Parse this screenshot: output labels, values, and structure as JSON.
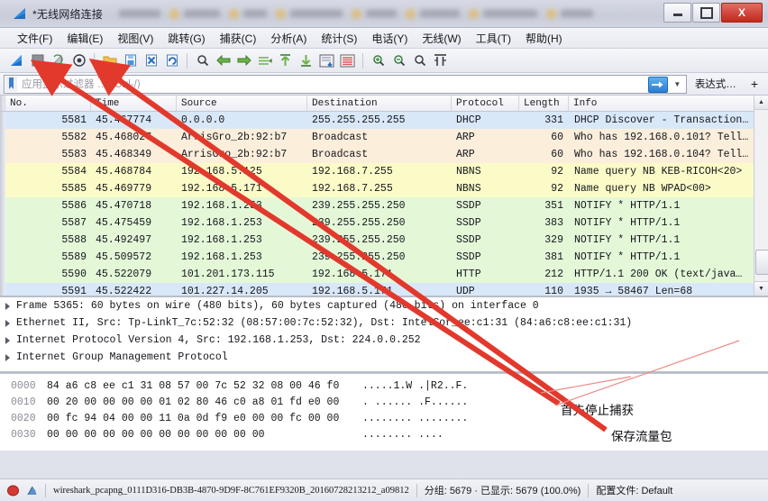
{
  "window": {
    "title": "*无线网络连接",
    "app_icon": "wireshark-fin-icon",
    "minimize_label": "",
    "maximize_label": "",
    "close_label": "X"
  },
  "menu": {
    "items": [
      {
        "label": "文件(F)",
        "name": "menu-file"
      },
      {
        "label": "编辑(E)",
        "name": "menu-edit"
      },
      {
        "label": "视图(V)",
        "name": "menu-view"
      },
      {
        "label": "跳转(G)",
        "name": "menu-go"
      },
      {
        "label": "捕获(C)",
        "name": "menu-capture"
      },
      {
        "label": "分析(A)",
        "name": "menu-analyze"
      },
      {
        "label": "统计(S)",
        "name": "menu-statistics"
      },
      {
        "label": "电话(Y)",
        "name": "menu-telephony"
      },
      {
        "label": "无线(W)",
        "name": "menu-wireless"
      },
      {
        "label": "工具(T)",
        "name": "menu-tools"
      },
      {
        "label": "帮助(H)",
        "name": "menu-help"
      }
    ]
  },
  "toolbar": {
    "buttons": [
      {
        "name": "start-capture-icon",
        "glyph": "start"
      },
      {
        "name": "stop-capture-icon",
        "glyph": "stop"
      },
      {
        "name": "restart-capture-icon",
        "glyph": "restart"
      },
      {
        "name": "capture-options-icon",
        "glyph": "options"
      },
      {
        "name": "open-file-icon",
        "glyph": "open"
      },
      {
        "name": "save-file-icon",
        "glyph": "save"
      },
      {
        "name": "close-file-icon",
        "glyph": "close"
      },
      {
        "name": "reload-file-icon",
        "glyph": "reload"
      },
      {
        "name": "find-packet-icon",
        "glyph": "find"
      },
      {
        "name": "go-back-icon",
        "glyph": "back"
      },
      {
        "name": "go-forward-icon",
        "glyph": "forward"
      },
      {
        "name": "go-to-packet-icon",
        "glyph": "goto"
      },
      {
        "name": "go-first-packet-icon",
        "glyph": "first"
      },
      {
        "name": "go-last-packet-icon",
        "glyph": "last"
      },
      {
        "name": "auto-scroll-icon",
        "glyph": "autoscroll"
      },
      {
        "name": "colorize-icon",
        "glyph": "colorize"
      },
      {
        "name": "zoom-in-icon",
        "glyph": "zoomin"
      },
      {
        "name": "zoom-out-icon",
        "glyph": "zoomout"
      },
      {
        "name": "zoom-reset-icon",
        "glyph": "zoomreset"
      },
      {
        "name": "resize-columns-icon",
        "glyph": "resizecols"
      }
    ]
  },
  "filter": {
    "placeholder": "应用显示过滤器 … ⟨Ctrl-/⟩",
    "value": "",
    "bookmark_icon": "bookmark-icon",
    "apply_icon": "arrow-right-icon",
    "dropdown_icon": "chevron-down-icon",
    "expression_label": "表达式…",
    "plus_label": "+"
  },
  "packet_list": {
    "columns": [
      "No.",
      "Time",
      "Source",
      "Destination",
      "Protocol",
      "Length",
      "Info"
    ],
    "rows": [
      {
        "no": "5581",
        "time": "45.467774",
        "src": "0.0.0.0",
        "dst": "255.255.255.255",
        "proto": "DHCP",
        "len": "331",
        "info": "DHCP Discover - Transaction…",
        "color": "selected"
      },
      {
        "no": "5582",
        "time": "45.468027",
        "src": "ArrisGro_2b:92:b7",
        "dst": "Broadcast",
        "proto": "ARP",
        "len": "60",
        "info": "Who has 192.168.0.101? Tell…",
        "color": "tan"
      },
      {
        "no": "5583",
        "time": "45.468349",
        "src": "ArrisGro_2b:92:b7",
        "dst": "Broadcast",
        "proto": "ARP",
        "len": "60",
        "info": "Who has 192.168.0.104? Tell…",
        "color": "tan"
      },
      {
        "no": "5584",
        "time": "45.468784",
        "src": "192.168.5.125",
        "dst": "192.168.7.255",
        "proto": "NBNS",
        "len": "92",
        "info": "Name query NB KEB-RICOH<20>",
        "color": "yellow"
      },
      {
        "no": "5585",
        "time": "45.469779",
        "src": "192.168.5.171",
        "dst": "192.168.7.255",
        "proto": "NBNS",
        "len": "92",
        "info": "Name query NB WPAD<00>",
        "color": "yellow"
      },
      {
        "no": "5586",
        "time": "45.470718",
        "src": "192.168.1.253",
        "dst": "239.255.255.250",
        "proto": "SSDP",
        "len": "351",
        "info": "NOTIFY * HTTP/1.1",
        "color": "green"
      },
      {
        "no": "5587",
        "time": "45.475459",
        "src": "192.168.1.253",
        "dst": "239.255.255.250",
        "proto": "SSDP",
        "len": "383",
        "info": "NOTIFY * HTTP/1.1",
        "color": "green"
      },
      {
        "no": "5588",
        "time": "45.492497",
        "src": "192.168.1.253",
        "dst": "239.255.255.250",
        "proto": "SSDP",
        "len": "329",
        "info": "NOTIFY * HTTP/1.1",
        "color": "green"
      },
      {
        "no": "5589",
        "time": "45.509572",
        "src": "192.168.1.253",
        "dst": "239.255.255.250",
        "proto": "SSDP",
        "len": "381",
        "info": "NOTIFY * HTTP/1.1",
        "color": "green"
      },
      {
        "no": "5590",
        "time": "45.522079",
        "src": "101.201.173.115",
        "dst": "192.168.5.171",
        "proto": "HTTP",
        "len": "212",
        "info": "HTTP/1.1 200 OK  (text/java…",
        "color": "green"
      },
      {
        "no": "5591",
        "time": "45.522422",
        "src": "101.227.14.205",
        "dst": "192.168.5.171",
        "proto": "UDP",
        "len": "110",
        "info": "1935 → 58467  Len=68",
        "color": "blue"
      }
    ]
  },
  "details": {
    "rows": [
      {
        "text": "Frame 5365: 60 bytes on wire (480 bits), 60 bytes captured (480 bits) on interface 0",
        "name": "detail-frame"
      },
      {
        "text": "Ethernet II, Src: Tp-LinkT_7c:52:32 (08:57:00:7c:52:32), Dst: IntelCor_ee:c1:31 (84:a6:c8:ee:c1:31)",
        "name": "detail-ethernet"
      },
      {
        "text": "Internet Protocol Version 4, Src: 192.168.1.253, Dst: 224.0.0.252",
        "name": "detail-ipv4"
      },
      {
        "text": "Internet Group Management Protocol",
        "name": "detail-igmp"
      }
    ]
  },
  "bytes": {
    "rows": [
      {
        "offset": "0000",
        "hex": "84 a6 c8 ee c1 31 08 57   00 7c 52 32 08 00 46 f0",
        "ascii": ".....1.W .|R2..F."
      },
      {
        "offset": "0010",
        "hex": "00 20 00 00 00 00 01 02   80 46 c0 a8 01 fd e0 00",
        "ascii": ". ...... .F......"
      },
      {
        "offset": "0020",
        "hex": "00 fc 94 04 00 00 11 0a   0d f9 e0 00 00 fc 00 00",
        "ascii": "........ ........"
      },
      {
        "offset": "0030",
        "hex": "00 00 00 00 00 00 00 00   00 00 00 00",
        "ascii": "........ ...."
      }
    ]
  },
  "annotations": [
    {
      "text": "首先停止捕获",
      "name": "annotation-stop-capture"
    },
    {
      "text": "保存流量包",
      "name": "annotation-save-packets"
    }
  ],
  "statusbar": {
    "expert_icon": "expert-error-icon",
    "profile_icon": "capture-file-icon",
    "capture_file": "wireshark_pcapng_0111D316-DB3B-4870-9D9F-8C761EF9320B_20160728213212_a09812",
    "packets": "分组: 5679 · 已显示: 5679 (100.0%)",
    "profile": "配置文件: Default"
  },
  "colors": {
    "selected_row": "#d9e8f8",
    "tan_row": "#fbeedb",
    "yellow_row": "#fbfbc8",
    "green_row": "#e4f8d8",
    "blue_row": "#d9e8f8",
    "annotation_arrow": "#e03a2f",
    "accent_blue": "#2a7fd4"
  }
}
